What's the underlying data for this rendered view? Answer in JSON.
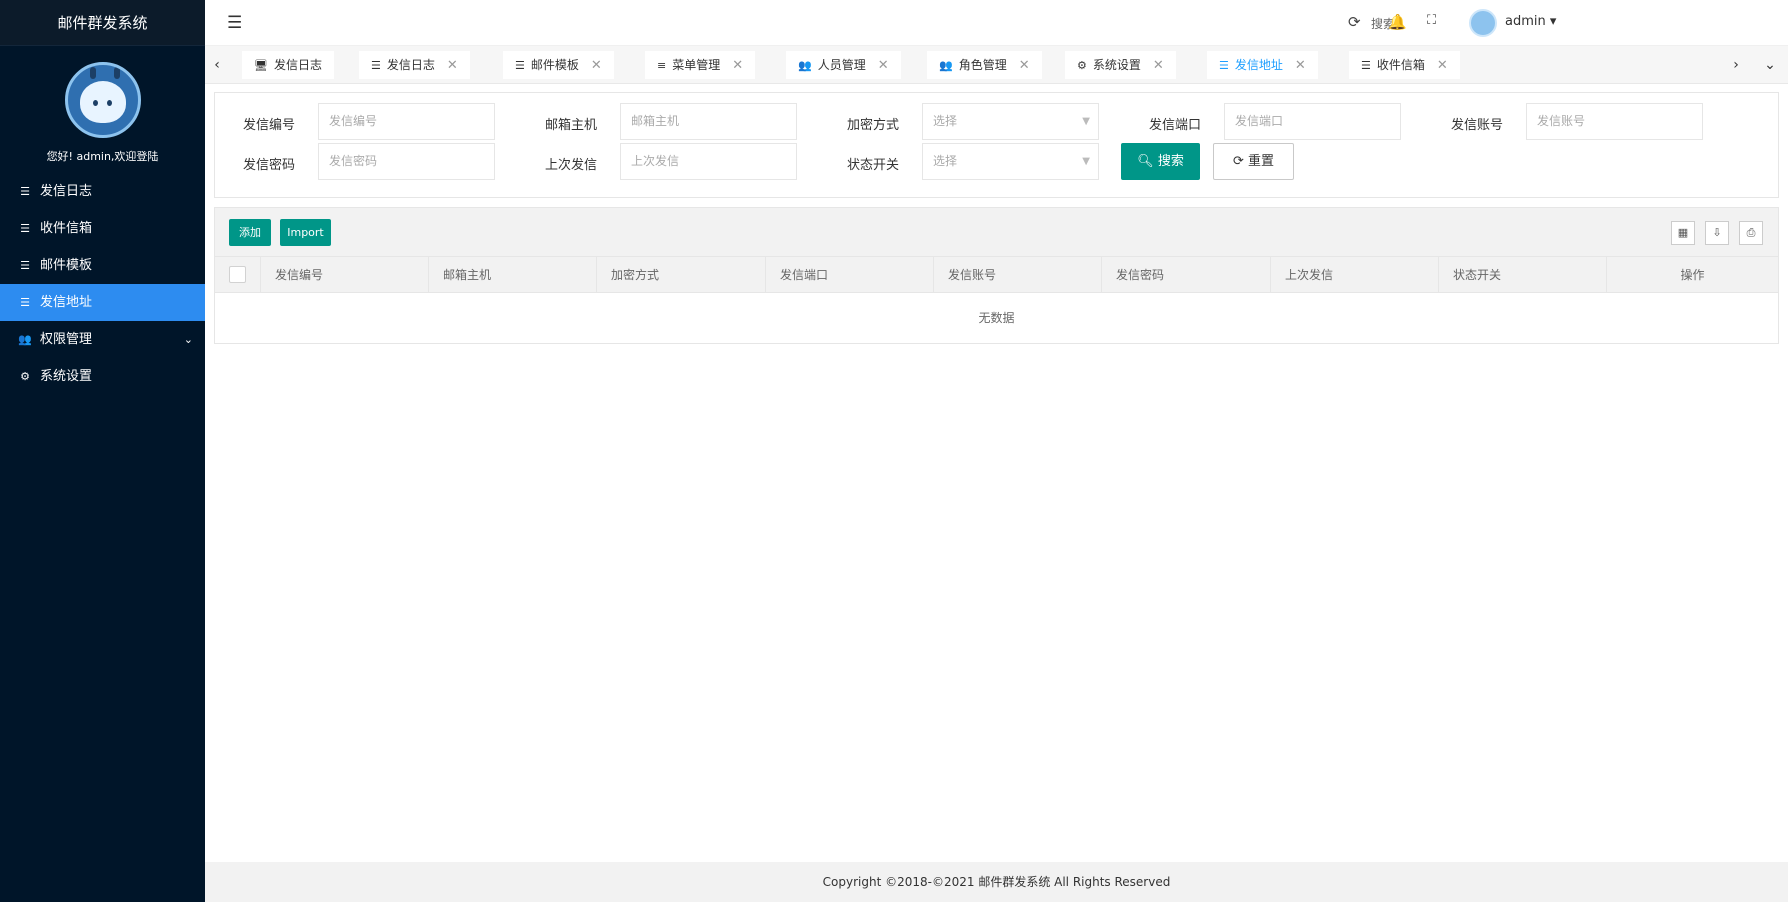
{
  "app": {
    "title": "邮件群发系统"
  },
  "profile": {
    "welcome": "您好! admin,欢迎登陆"
  },
  "sidebar": {
    "items": [
      {
        "label": "发信日志",
        "icon": "list-icon"
      },
      {
        "label": "收件信箱",
        "icon": "list-icon"
      },
      {
        "label": "邮件模板",
        "icon": "list-icon"
      },
      {
        "label": "发信地址",
        "icon": "list-icon",
        "active": true
      },
      {
        "label": "权限管理",
        "icon": "users-icon",
        "expandable": true
      },
      {
        "label": "系统设置",
        "icon": "gear-icon"
      }
    ]
  },
  "header": {
    "search_label": "搜索",
    "user": "admin"
  },
  "tabs": [
    {
      "label": "发信日志",
      "icon": "monitor-icon",
      "closable": false
    },
    {
      "label": "发信日志",
      "icon": "list-icon",
      "closable": true
    },
    {
      "label": "邮件模板",
      "icon": "list-icon",
      "closable": true
    },
    {
      "label": "菜单管理",
      "icon": "bars-icon",
      "closable": true
    },
    {
      "label": "人员管理",
      "icon": "users-icon",
      "closable": true
    },
    {
      "label": "角色管理",
      "icon": "users-icon",
      "closable": true
    },
    {
      "label": "系统设置",
      "icon": "gear-icon",
      "closable": true
    },
    {
      "label": "发信地址",
      "icon": "list-icon",
      "closable": true,
      "active": true
    },
    {
      "label": "收件信箱",
      "icon": "list-icon",
      "closable": true
    }
  ],
  "form": {
    "fields": [
      {
        "label": "发信编号",
        "placeholder": "发信编号",
        "type": "text"
      },
      {
        "label": "邮箱主机",
        "placeholder": "邮箱主机",
        "type": "text"
      },
      {
        "label": "加密方式",
        "placeholder": "选择",
        "type": "select"
      },
      {
        "label": "发信端口",
        "placeholder": "发信端口",
        "type": "text"
      },
      {
        "label": "发信账号",
        "placeholder": "发信账号",
        "type": "text"
      },
      {
        "label": "发信密码",
        "placeholder": "发信密码",
        "type": "text"
      },
      {
        "label": "上次发信",
        "placeholder": "上次发信",
        "type": "text"
      },
      {
        "label": "状态开关",
        "placeholder": "选择",
        "type": "select"
      }
    ],
    "search_button": "搜索",
    "reset_button": "重置"
  },
  "table": {
    "add_button": "添加",
    "import_button": "Import",
    "columns": [
      "发信编号",
      "邮箱主机",
      "加密方式",
      "发信端口",
      "发信账号",
      "发信密码",
      "上次发信",
      "状态开关",
      "操作"
    ],
    "empty_text": "无数据"
  },
  "footer": {
    "copyright": "Copyright ©2018-©2021 邮件群发系统 All Rights Reserved"
  },
  "colors": {
    "sidebar_bg": "#001529",
    "active": "#2d8cf0",
    "primary_button": "#009688",
    "active_tab_text": "#1E9FFF"
  }
}
